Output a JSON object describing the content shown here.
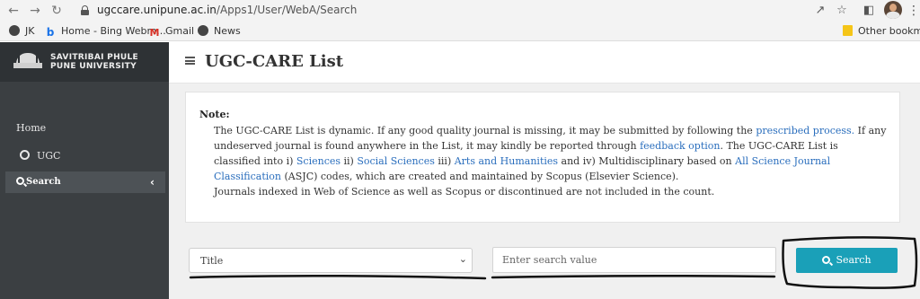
{
  "browser": {
    "url_host": "ugccare.unipune.ac.in",
    "url_path": "/Apps1/User/WebA/Search",
    "icons": [
      "back-icon",
      "forward-icon",
      "reload-icon",
      "share-icon",
      "star-icon",
      "sidepanel-icon",
      "avatar",
      "menu-icon"
    ]
  },
  "bookmarks": {
    "items": [
      {
        "label": "JK",
        "icon": "globe-icon"
      },
      {
        "label": "Home - Bing Webm...",
        "icon": "bing-icon"
      },
      {
        "label": "Gmail",
        "icon": "gmail-icon"
      },
      {
        "label": "News",
        "icon": "globe-icon"
      }
    ],
    "other": "Other bookma"
  },
  "sidebar": {
    "logo_line1": "SAVITRIBAI PHULE",
    "logo_line2": "PUNE UNIVERSITY",
    "items": [
      {
        "label": "Home"
      },
      {
        "label": "UGC",
        "icon": "circle-icon"
      },
      {
        "label": "Search",
        "icon": "search-icon",
        "active": true
      }
    ]
  },
  "header": {
    "title": "UGC-CARE List"
  },
  "note": {
    "heading": "Note:",
    "p1_a": "The UGC-CARE List is dynamic. If any good quality journal is missing, it may be submitted by following the ",
    "p1_link1": "prescribed process.",
    "p1_b": " If any undeserved journal is found anywhere in the List, it may kindly be reported through ",
    "p1_link2": "feedback option",
    "p1_c": ". The UGC-CARE List is classified into i) ",
    "p1_link3": "Sciences",
    "p1_d": " ii) ",
    "p1_link4": "Social Sciences",
    "p1_e": " iii) ",
    "p1_link5": "Arts and Humanities",
    "p1_f": " and iv) Multidisciplinary based on ",
    "p1_link6": "All Science Journal Classification",
    "p1_g": " (ASJC) codes, which are created and maintained by Scopus (Elsevier Science).",
    "p2": "Journals indexed in Web of Science as well as Scopus or discontinued are not included in the count."
  },
  "search": {
    "field_selected": "Title",
    "input_placeholder": "Enter search value",
    "button_label": "Search"
  },
  "colors": {
    "sidebar_bg": "#3b3f42",
    "button_accent": "#1aa0b8",
    "link": "#2a6ebd"
  }
}
